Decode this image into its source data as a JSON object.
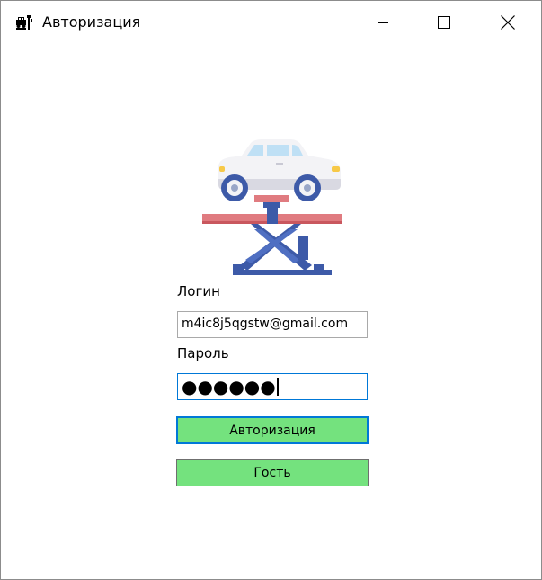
{
  "window": {
    "title": "Авторизация",
    "icon": "car-service-icon"
  },
  "titlebar_controls": {
    "minimize_icon": "minimize-icon",
    "maximize_icon": "maximize-icon",
    "close_icon": "close-icon"
  },
  "logo": {
    "icon": "car-lift-icon"
  },
  "form": {
    "login_label": "Логин",
    "login_value": "m4ic8j5qgstw@gmail.com",
    "password_label": "Пароль",
    "password_masked": "●●●●●●",
    "login_button": "Авторизация",
    "guest_button": "Гость"
  },
  "colors": {
    "button_fill": "#74e27e",
    "focus_border": "#0078d7"
  }
}
